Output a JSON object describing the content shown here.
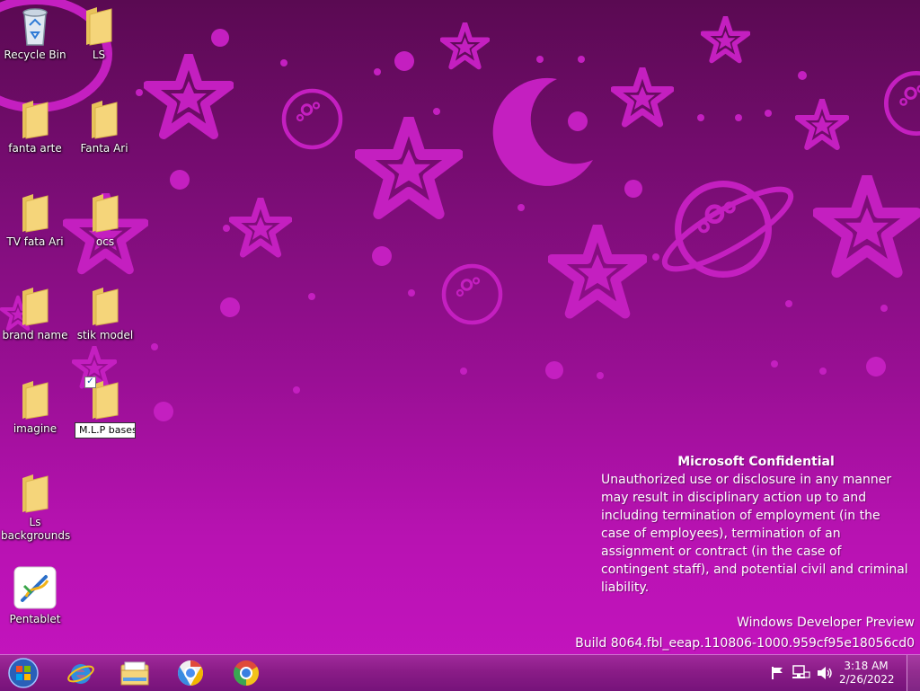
{
  "desktop": {
    "icons": [
      {
        "label": "Recycle Bin",
        "type": "recycle"
      },
      {
        "label": "LS",
        "type": "folder"
      },
      {
        "label": "fanta arte",
        "type": "folder"
      },
      {
        "label": "Fanta Ari",
        "type": "folder"
      },
      {
        "label": "TV  fata Ari",
        "type": "folder"
      },
      {
        "label": "ocs",
        "type": "folder"
      },
      {
        "label": "brand name",
        "type": "folder"
      },
      {
        "label": "stik  model",
        "type": "folder"
      },
      {
        "label": "imagine",
        "type": "folder"
      },
      {
        "label": "M.L.P bases",
        "type": "folder",
        "renaming": true
      },
      {
        "label": "Ls backgrounds",
        "type": "folder"
      },
      {
        "label": "Pentablet",
        "type": "app"
      }
    ]
  },
  "watermark": {
    "title": "Microsoft Confidential",
    "body": "Unauthorized use or disclosure in any manner may result in disciplinary action up to and including termination of employment (in the case of employees), termination of an assignment or contract (in the case of contingent staff), and potential civil and criminal liability.",
    "edition": "Windows Developer Preview",
    "build": "Build 8064.fbl_eeap.110806-1000.959cf95e18056cd0"
  },
  "taskbar": {
    "pinned": [
      "start-orb-icon",
      "internet-explorer-icon",
      "file-explorer-icon",
      "chromium-icon",
      "chrome-icon"
    ],
    "tray_icons": [
      "flag-icon",
      "network-icon",
      "speaker-icon"
    ],
    "time": "3:18 AM",
    "date": "2/26/2022"
  },
  "colors": {
    "wallpaper_shape": "#c41fc0",
    "taskbar": "#8a1c87",
    "folder": "#f5d57a"
  }
}
